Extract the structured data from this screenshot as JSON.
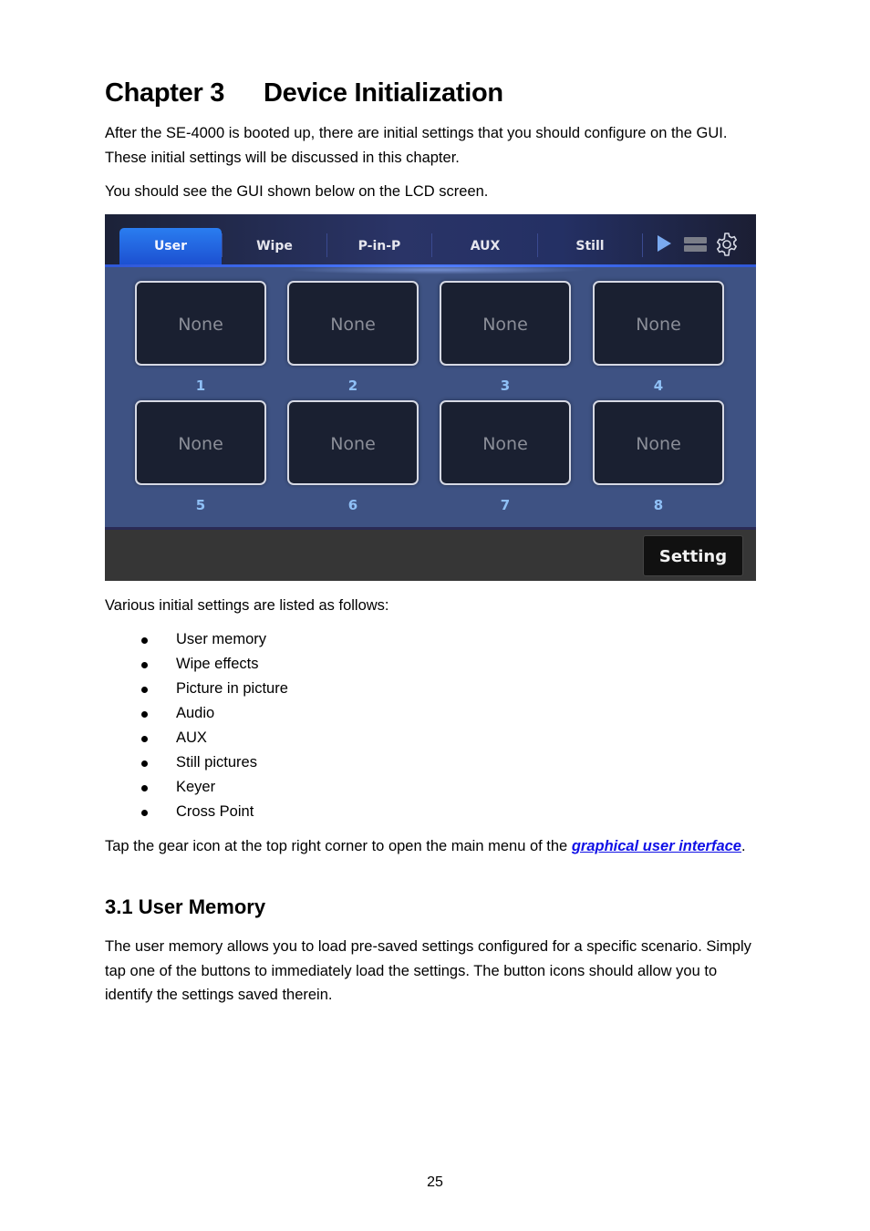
{
  "heading": {
    "chapter": "Chapter 3",
    "title": "Device Initialization"
  },
  "intro": {
    "paragraph1": "After the SE-4000 is booted up, there are initial settings that you should configure on the GUI. These initial settings will be discussed in this chapter.",
    "paragraph2": "You should see the GUI shown below on the LCD screen."
  },
  "gui": {
    "tabs": [
      {
        "label": "User",
        "active": true
      },
      {
        "label": "Wipe",
        "active": false
      },
      {
        "label": "P-in-P",
        "active": false
      },
      {
        "label": "AUX",
        "active": false
      },
      {
        "label": "Still",
        "active": false
      }
    ],
    "icons": [
      "play-icon",
      "server-icon",
      "gear-icon"
    ],
    "memory_buttons": [
      {
        "label": "None",
        "number": "1"
      },
      {
        "label": "None",
        "number": "2"
      },
      {
        "label": "None",
        "number": "3"
      },
      {
        "label": "None",
        "number": "4"
      },
      {
        "label": "None",
        "number": "5"
      },
      {
        "label": "None",
        "number": "6"
      },
      {
        "label": "None",
        "number": "7"
      },
      {
        "label": "None",
        "number": "8"
      }
    ],
    "setting_button": "Setting",
    "colors": {
      "active_tab": "#1c4fd0",
      "panel_bg": "#3e5283",
      "button_bg": "#1a2031",
      "number_color": "#8fc0f6"
    }
  },
  "settings_intro": "Various initial settings are listed as follows:",
  "settings_list": [
    "User memory",
    "Wipe effects",
    "Picture in picture",
    "Audio",
    "AUX",
    "Still pictures",
    "Keyer",
    "Cross Point"
  ],
  "gear_note": {
    "before": "Tap the gear icon at the top right corner to open the main menu of the ",
    "link": "graphical user interface",
    "after": "."
  },
  "section": {
    "title": "3.1 User Memory",
    "body": "The user memory allows you to load pre-saved settings configured for a specific scenario. Simply tap one of the buttons to immediately load the settings. The button icons should allow you to identify the settings saved therein."
  },
  "page_number": "25"
}
